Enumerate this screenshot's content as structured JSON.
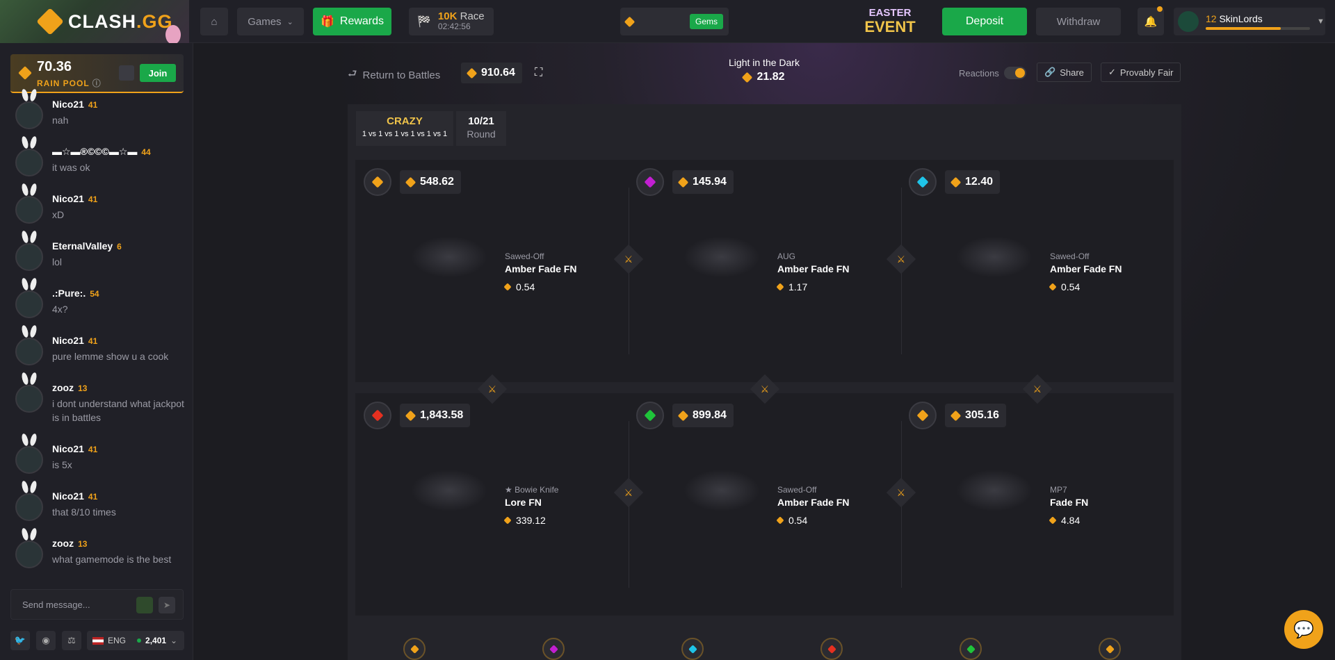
{
  "brand": {
    "name_main": "CLASH",
    "name_suffix": ".GG"
  },
  "nav": {
    "games_label": "Games",
    "rewards_label": "Rewards",
    "race_amount": "10K",
    "race_label": "Race",
    "race_timer": "02:42:56",
    "gems_label": "Gems",
    "event_line1": "EASTER",
    "event_line2": "EVENT",
    "deposit_label": "Deposit",
    "withdraw_label": "Withdraw",
    "user_level": "12",
    "username": "SkinLords"
  },
  "rain": {
    "amount": "70.36",
    "label": "RAIN POOL",
    "join_label": "Join"
  },
  "chat": {
    "messages": [
      {
        "name": "Nico21",
        "level": "41",
        "text": "nah"
      },
      {
        "name": "▬☆▬®©©©▬☆▬",
        "level": "44",
        "text": "it was ok"
      },
      {
        "name": "Nico21",
        "level": "41",
        "text": "xD"
      },
      {
        "name": "EternalValley",
        "level": "6",
        "text": "lol"
      },
      {
        "name": ".:Pure:.",
        "level": "54",
        "text": "4x?"
      },
      {
        "name": "Nico21",
        "level": "41",
        "text": "pure lemme show u a cook"
      },
      {
        "name": "zooz",
        "level": "13",
        "text": "i dont understand what jackpot is in battles"
      },
      {
        "name": "Nico21",
        "level": "41",
        "text": "is 5x"
      },
      {
        "name": "Nico21",
        "level": "41",
        "text": "that 8/10 times"
      },
      {
        "name": "zooz",
        "level": "13",
        "text": "what gamemode is the best"
      }
    ],
    "input_placeholder": "Send message...",
    "language": "ENG",
    "online_count": "2,401"
  },
  "battle": {
    "return_label": "Return to Battles",
    "total_value": "910.64",
    "case_name": "Light in the Dark",
    "case_price": "21.82",
    "reactions_label": "Reactions",
    "share_label": "Share",
    "provably_fair_label": "Provably Fair",
    "mode": "CRAZY",
    "format": "1 vs 1 vs 1 vs 1 vs 1 vs 1",
    "round_value": "10/21",
    "round_label": "Round",
    "reactions": [
      "🐸",
      "🔥",
      "🍀",
      "🦅",
      "🙏"
    ],
    "players": [
      {
        "gem_color": "#f0a21a",
        "total": "548.62",
        "item_type": "Sawed-Off",
        "item_name": "Amber Fade FN",
        "item_value": "0.54"
      },
      {
        "gem_color": "#c21fd1",
        "total": "145.94",
        "item_type": "AUG",
        "item_name": "Amber Fade FN",
        "item_value": "1.17"
      },
      {
        "gem_color": "#1fc4e8",
        "total": "12.40",
        "item_type": "Sawed-Off",
        "item_name": "Amber Fade FN",
        "item_value": "0.54"
      },
      {
        "gem_color": "#e53020",
        "total": "1,843.58",
        "item_type": "★ Bowie Knife",
        "item_name": "Lore FN",
        "item_value": "339.12"
      },
      {
        "gem_color": "#1fc43a",
        "total": "899.84",
        "item_type": "Sawed-Off",
        "item_name": "Amber Fade FN",
        "item_value": "0.54"
      },
      {
        "gem_color": "#f0a21a",
        "total": "305.16",
        "item_type": "MP7",
        "item_name": "Fade FN",
        "item_value": "4.84"
      }
    ]
  }
}
